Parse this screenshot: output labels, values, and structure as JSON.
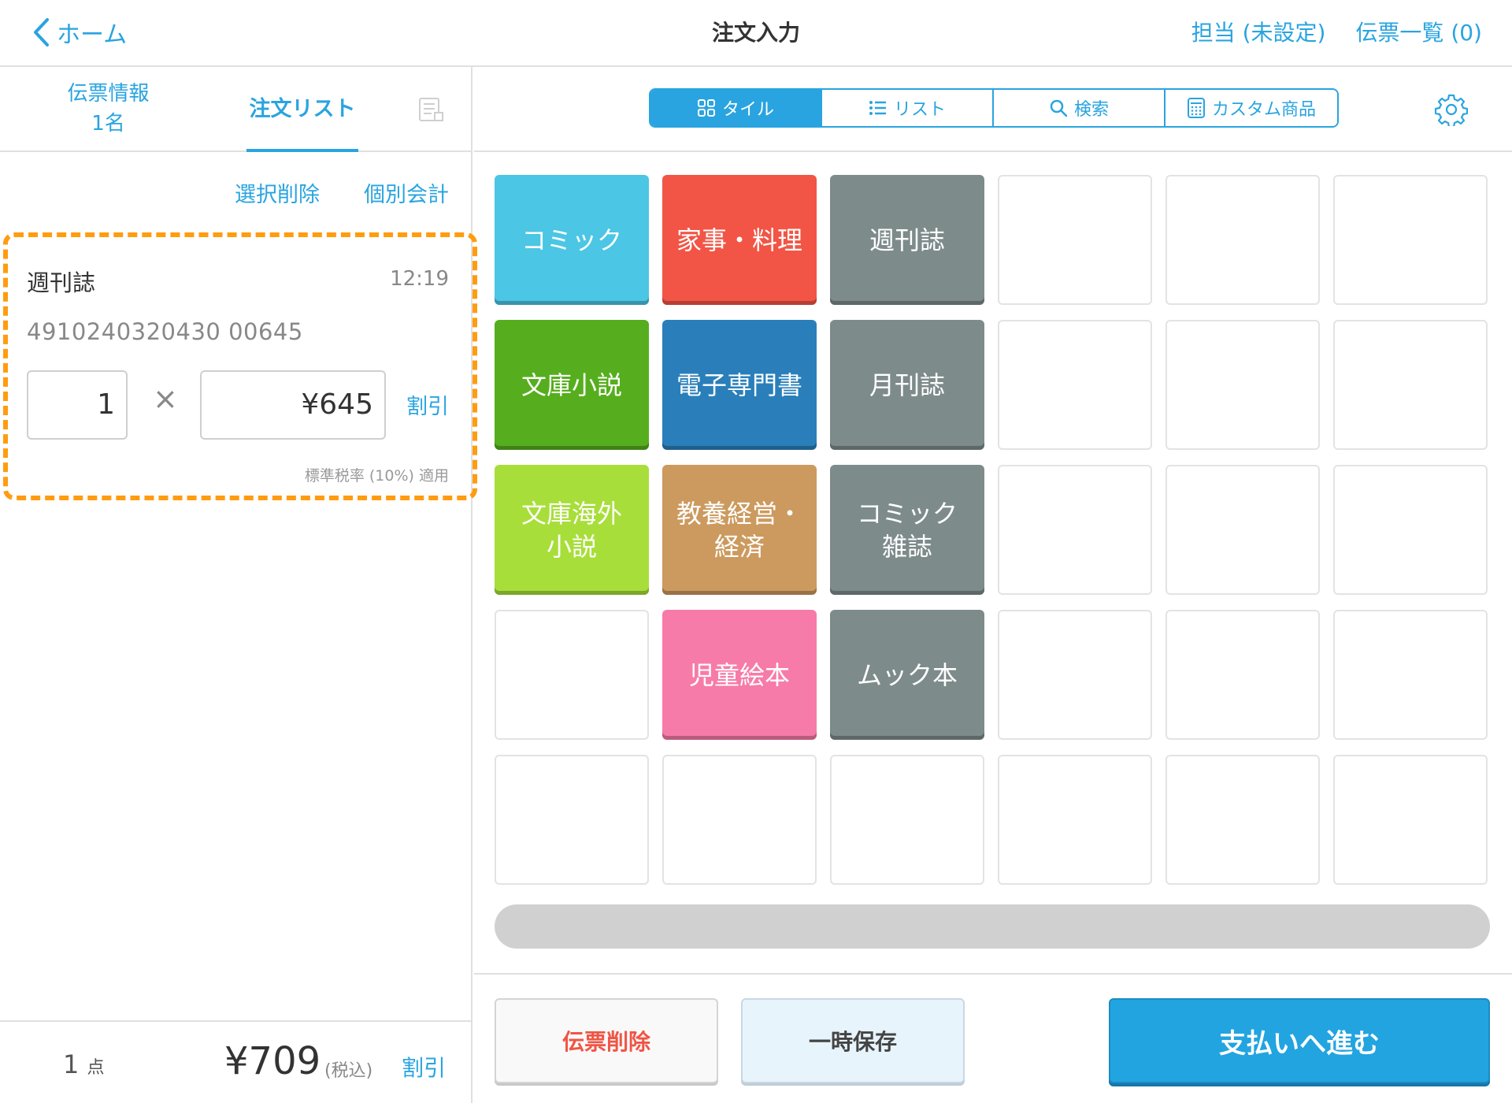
{
  "header": {
    "back_label": "ホーム",
    "title": "注文入力",
    "staff_label": "担当 (未設定)",
    "slip_list_label": "伝票一覧 (0)"
  },
  "left_tabs": {
    "info_line1": "伝票情報",
    "info_line2": "1名",
    "orders_label": "注文リスト",
    "receipt_icon": "receipt-icon"
  },
  "list_actions": {
    "delete_selected": "選択削除",
    "split_payment": "個別会計"
  },
  "order_item": {
    "name": "週刊誌",
    "time": "12:19",
    "code": "4910240320430 00645",
    "quantity": "1",
    "times_symbol": "×",
    "price": "¥645",
    "discount_label": "割引",
    "tax_note": "標準税率 (10%) 適用"
  },
  "footer": {
    "count": "1",
    "count_unit": "点",
    "total": "¥709",
    "total_note": "(税込)",
    "discount_label": "割引"
  },
  "view_modes": [
    {
      "label": "タイル",
      "icon": "grid-icon",
      "active": true
    },
    {
      "label": "リスト",
      "icon": "list-icon",
      "active": false
    },
    {
      "label": "検索",
      "icon": "search-icon",
      "active": false
    },
    {
      "label": "カスタム商品",
      "icon": "calculator-icon",
      "active": false
    }
  ],
  "settings_icon": "gear-icon",
  "tiles": [
    {
      "label": "コミック",
      "color": "#4bc6e4"
    },
    {
      "label": "家事・料理",
      "color": "#f25545"
    },
    {
      "label": "週刊誌",
      "color": "#7e8b8b"
    },
    {
      "label": "",
      "color": ""
    },
    {
      "label": "",
      "color": ""
    },
    {
      "label": "",
      "color": ""
    },
    {
      "label": "文庫小説",
      "color": "#56ae1e"
    },
    {
      "label": "電子専門書",
      "color": "#2a7fba"
    },
    {
      "label": "月刊誌",
      "color": "#7e8b8b"
    },
    {
      "label": "",
      "color": ""
    },
    {
      "label": "",
      "color": ""
    },
    {
      "label": "",
      "color": ""
    },
    {
      "label": "文庫海外\n小説",
      "color": "#a8de3a"
    },
    {
      "label": "教養経営・\n経済",
      "color": "#cc9a5e"
    },
    {
      "label": "コミック\n雑誌",
      "color": "#7e8b8b"
    },
    {
      "label": "",
      "color": ""
    },
    {
      "label": "",
      "color": ""
    },
    {
      "label": "",
      "color": ""
    },
    {
      "label": "",
      "color": ""
    },
    {
      "label": "児童絵本",
      "color": "#f77ba8"
    },
    {
      "label": "ムック本",
      "color": "#7e8b8b"
    },
    {
      "label": "",
      "color": ""
    },
    {
      "label": "",
      "color": ""
    },
    {
      "label": "",
      "color": ""
    },
    {
      "label": "",
      "color": ""
    },
    {
      "label": "",
      "color": ""
    },
    {
      "label": "",
      "color": ""
    },
    {
      "label": "",
      "color": ""
    },
    {
      "label": "",
      "color": ""
    },
    {
      "label": "",
      "color": ""
    }
  ],
  "actions": {
    "delete_slip": "伝票削除",
    "temp_save": "一時保存",
    "proceed_payment": "支払いへ進む"
  },
  "colors": {
    "accent": "#29a4e0",
    "highlight_border": "#ff9c0f",
    "danger": "#f05545"
  }
}
